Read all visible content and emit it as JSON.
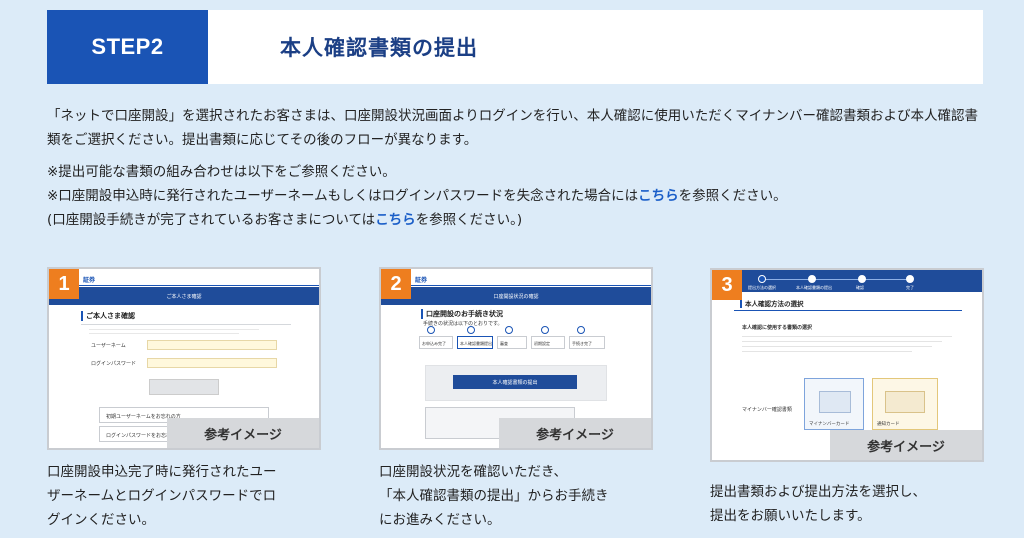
{
  "header": {
    "step": "STEP2",
    "title": "本人確認書類の提出"
  },
  "intro": "「ネットで口座開設」を選択されたお客さまは、口座開設状況画面よりログインを行い、本人確認に使用いただくマイナンバー確認書類および本人確認書類をご選択ください。提出書類に応じてその後のフローが異なります。",
  "notes": {
    "line1": "※提出可能な書類の組み合わせは以下をご参照ください。",
    "line2_pre": "※口座開設申込時に発行されたユーザーネームもしくはログインパスワードを失念された場合には",
    "line2_link": "こちら",
    "line2_post": "を参照ください。",
    "line3_pre": "(口座開設手続きが完了されているお客さまについては",
    "line3_link": "こちら",
    "line3_post": "を参照ください。)"
  },
  "cards": [
    {
      "num": "1",
      "ref": "参考イメージ",
      "caption": [
        "口座開設申込完了時に発行されたユー",
        "ザーネームとログインパスワードでロ",
        "グインください。"
      ],
      "shot": {
        "brand": "証券",
        "band": "ご本人さま確認",
        "heading": "ご本人さま確認",
        "field1": "ユーザーネーム",
        "field2": "ログインパスワード",
        "link1": "初期ユーザーネームをお忘れの方",
        "link2": "ログインパスワードをお忘れの方"
      }
    },
    {
      "num": "2",
      "ref": "参考イメージ",
      "caption": [
        "口座開設状況を確認いただき、",
        "「本人確認書類の提出」からお手続き",
        "にお進みください。"
      ],
      "shot": {
        "brand": "証券",
        "band": "口座開設状況の確認",
        "heading": "口座開設のお手続き状況",
        "sub": "手続きの状況は以下のとおりです。",
        "steps": [
          "お申込み完了",
          "本人確認書類提出",
          "審査",
          "初期設定",
          "手続き完了"
        ],
        "button": "本人確認書類の提出"
      }
    },
    {
      "num": "3",
      "ref": "参考イメージ",
      "caption": [
        "提出書類および提出方法を選択し、",
        "提出をお願いいたします。"
      ],
      "shot": {
        "steps": [
          "提出方法の選択",
          "本人確認書類の提出",
          "確認",
          "完了"
        ],
        "heading": "本人確認方法の選択",
        "sub": "本人確認に使用する書類の選択",
        "label": "マイナンバー確認書類",
        "opt1": "マイナンバーカード",
        "opt2": "通知カード"
      }
    }
  ]
}
